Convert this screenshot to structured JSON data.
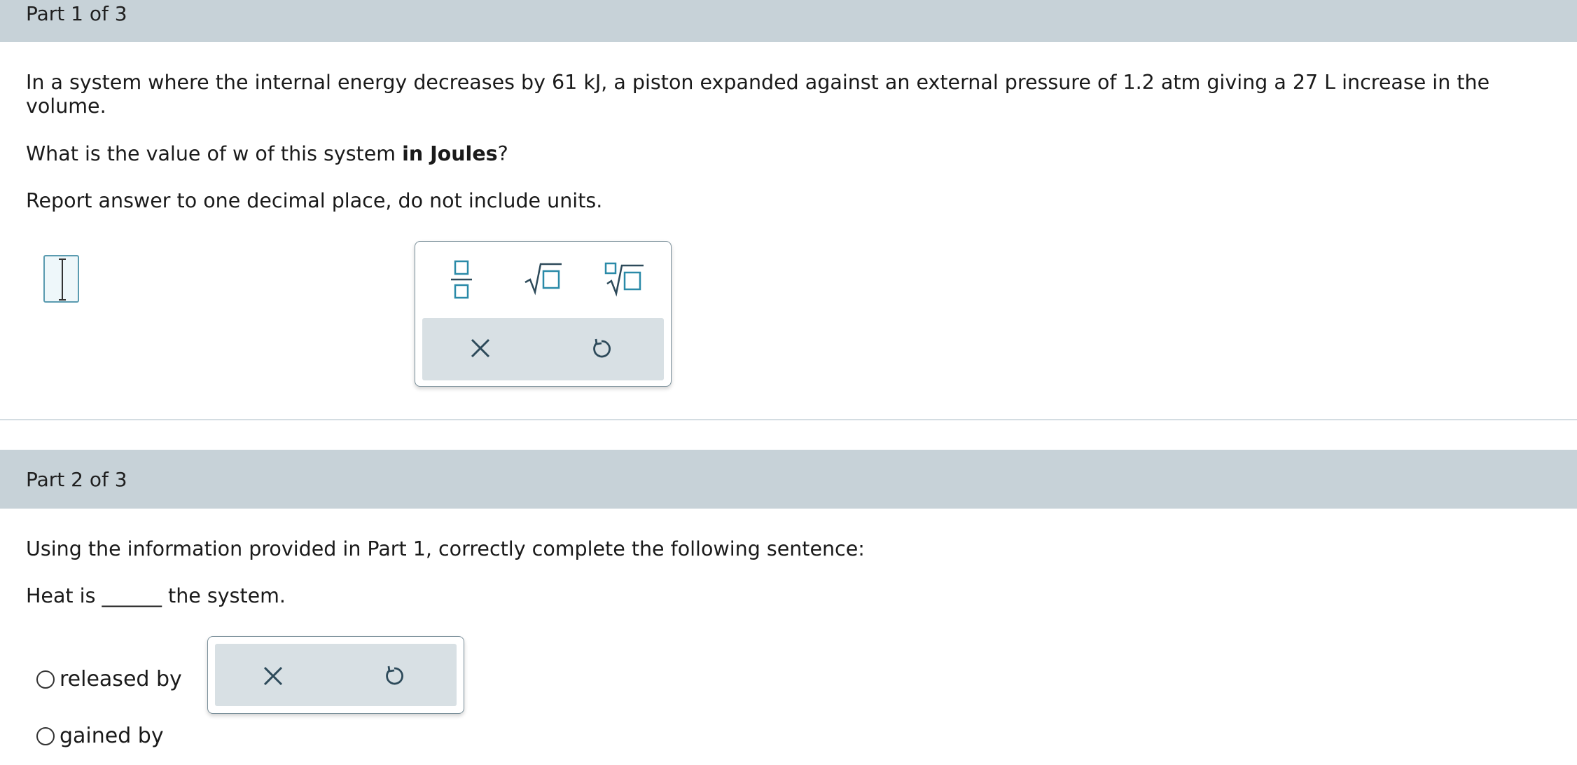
{
  "part1": {
    "header": "Part 1 of 3",
    "question_line1": "In a system where the internal energy decreases by 61 kJ, a piston expanded against an external pressure of 1.2 atm giving a 27 L increase in the",
    "question_line2": "volume.",
    "ask_prefix": "What is the value of w of this system ",
    "ask_bold": "in Joules",
    "ask_suffix": "?",
    "instruction": "Report answer to one decimal place, do not include units.",
    "answer_value": "",
    "tools": [
      "fraction-icon",
      "square-root-icon",
      "nth-root-icon"
    ],
    "actions": [
      "clear-icon",
      "undo-icon"
    ]
  },
  "part2": {
    "header": "Part 2 of 3",
    "prompt": "Using the information provided in Part 1, correctly complete the following sentence:",
    "sentence_prefix": "Heat is ",
    "blank": "______",
    "sentence_suffix": " the system.",
    "options": [
      {
        "label": "released by",
        "selected": false
      },
      {
        "label": "gained by",
        "selected": false
      }
    ],
    "actions": [
      "clear-icon",
      "undo-icon"
    ]
  },
  "colors": {
    "header_bg": "#c7d2d8",
    "accent": "#2a8aa8",
    "action_bar": "#d8e0e4",
    "icon_dark": "#2d4a5a"
  }
}
